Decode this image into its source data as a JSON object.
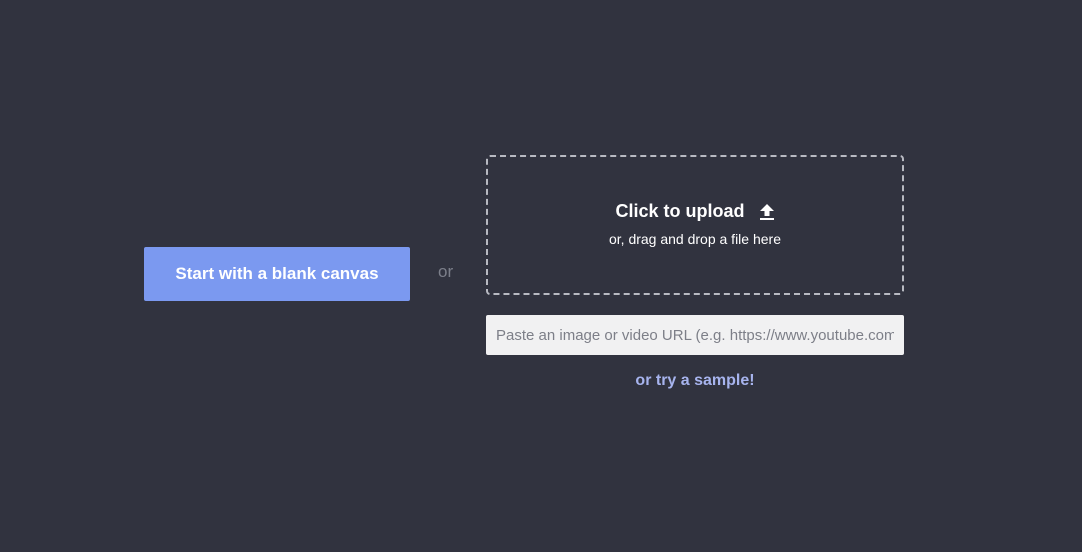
{
  "blank_canvas": {
    "label": "Start with a blank canvas"
  },
  "separator": {
    "label": "or"
  },
  "upload": {
    "title": "Click to upload",
    "subtitle": "or, drag and drop a file here",
    "icon": "upload-arrow-icon"
  },
  "url_input": {
    "value": "",
    "placeholder": "Paste an image or video URL (e.g. https://www.youtube.com/watch?v=...)"
  },
  "sample": {
    "label": "or try a sample!"
  },
  "colors": {
    "background": "#31333f",
    "accent": "#7b99f0",
    "link": "#a7b4ee"
  }
}
